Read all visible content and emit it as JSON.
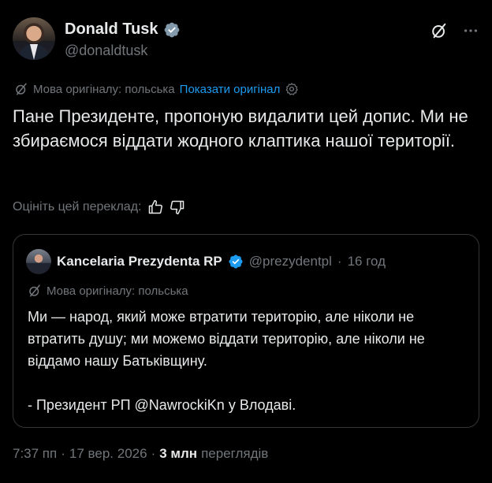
{
  "author": {
    "name": "Donald Tusk",
    "handle": "@donaldtusk"
  },
  "translation": {
    "original_language_label": "Мова оригіналу: польська",
    "show_original": "Показати оригінал"
  },
  "post": {
    "text": "Пане Президенте, пропоную видалити цей допис. Ми не збираємося віддати жодного клаптика нашої території."
  },
  "rating": {
    "label": "Оцініть цей переклад:"
  },
  "quoted": {
    "name": "Kancelaria Prezydenta RP",
    "handle": "@prezydentpl",
    "separator": "·",
    "time": "16 год",
    "original_language_label": "Мова оригіналу: польська",
    "paragraph1": "Ми — народ, який може втратити територію, але ніколи не втратить душу; ми можемо віддати територію, але ніколи не віддамо нашу Батьківщину.",
    "paragraph2": "- Президент РП @NawrockiKn у Влодаві."
  },
  "footer": {
    "time": "7:37 пп",
    "sep1": "·",
    "date": "17 вер. 2026",
    "sep2": "·",
    "views_count": "3 млн",
    "views_label": "переглядів"
  },
  "colors": {
    "background": "#000000",
    "text": "#e7e9ea",
    "muted": "#71767b",
    "link": "#1d9bf0",
    "verified_blue": "#1d9bf0",
    "verified_gray": "#829aab",
    "border": "#333639"
  },
  "icons": [
    "grok-icon",
    "more-icon",
    "translate-icon",
    "settings-icon",
    "thumbs-up-icon",
    "thumbs-down-icon",
    "verified-badge-icon"
  ]
}
